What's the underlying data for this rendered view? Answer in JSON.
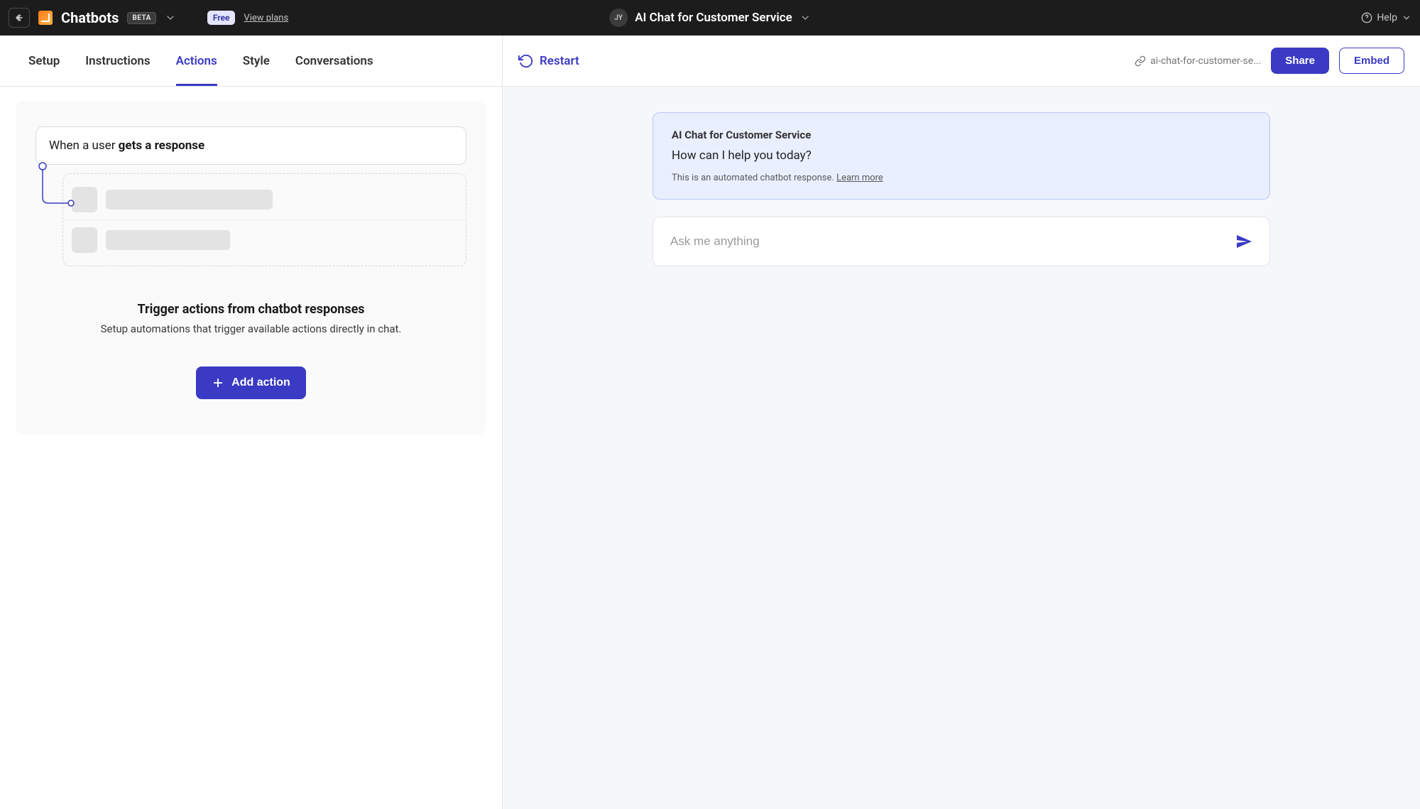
{
  "topbar": {
    "brand": "Chatbots",
    "beta": "BETA",
    "plan_pill": "Free",
    "view_plans": "View plans",
    "avatar_initials": "JY",
    "chatbot_title": "AI Chat for Customer Service",
    "help_label": "Help"
  },
  "tabs": {
    "items": [
      "Setup",
      "Instructions",
      "Actions",
      "Style",
      "Conversations"
    ],
    "active_index": 2
  },
  "actions_panel": {
    "trigger_prefix": "When a user ",
    "trigger_bold": "gets a response",
    "heading": "Trigger actions from chatbot responses",
    "subtext": "Setup automations that trigger available actions directly in chat.",
    "add_action_label": "Add action"
  },
  "right_toolbar": {
    "restart_label": "Restart",
    "slug": "ai-chat-for-customer-se...",
    "share_label": "Share",
    "embed_label": "Embed"
  },
  "chat": {
    "bot_name": "AI Chat for Customer Service",
    "welcome_msg": "How can I help you today?",
    "disclaimer_text": "This is an automated chatbot response. ",
    "learn_more": "Learn more",
    "input_placeholder": "Ask me anything"
  }
}
